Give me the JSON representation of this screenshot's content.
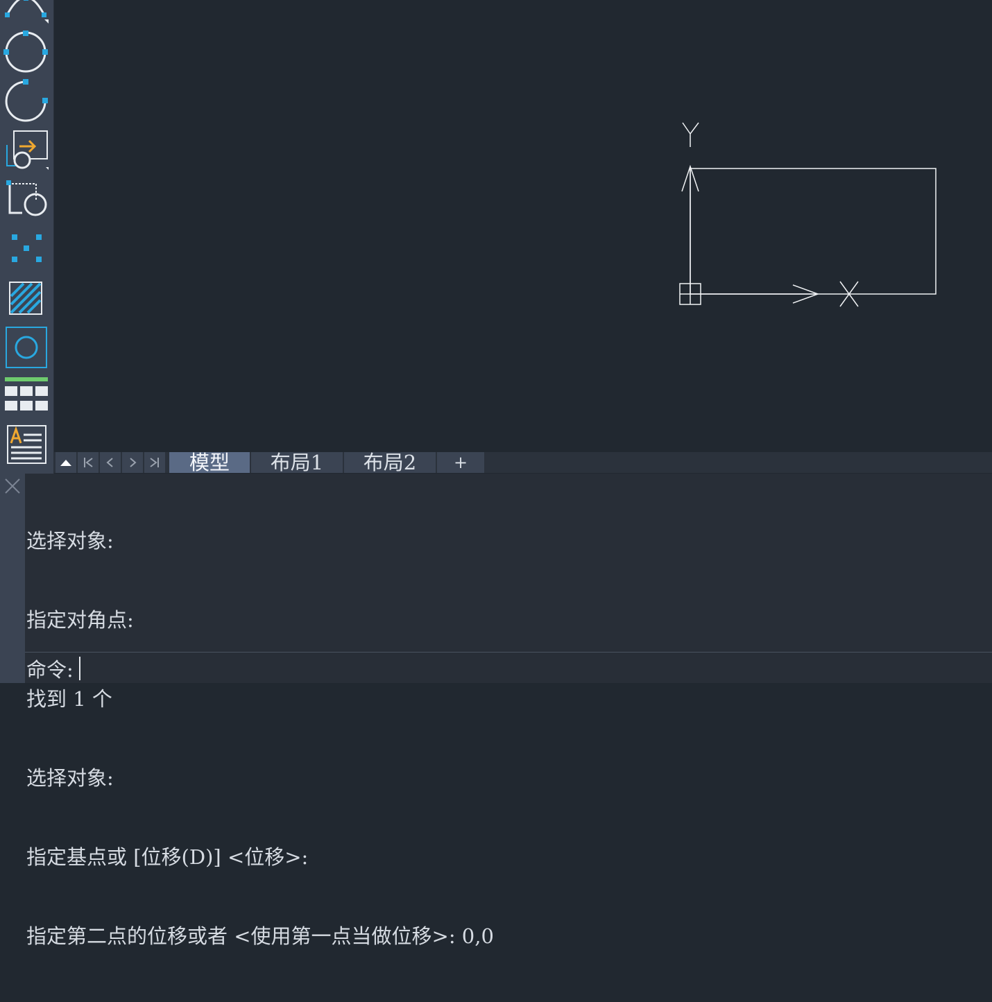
{
  "toolbar": {
    "tools": [
      {
        "name": "arc-icon"
      },
      {
        "name": "circle-icon"
      },
      {
        "name": "revision-cloud-icon"
      },
      {
        "name": "move-icon"
      },
      {
        "name": "block-icon"
      },
      {
        "name": "point-icon"
      },
      {
        "name": "hatch-icon"
      },
      {
        "name": "region-icon"
      },
      {
        "name": "table-icon"
      },
      {
        "name": "mtext-icon"
      }
    ]
  },
  "canvas": {
    "ucs": {
      "y_label": "Y",
      "x_label": "X"
    }
  },
  "tabs": {
    "items": [
      {
        "label": "模型",
        "active": true
      },
      {
        "label": "布局1",
        "active": false
      },
      {
        "label": "布局2",
        "active": false
      }
    ],
    "add_label": "+"
  },
  "command": {
    "history": [
      "选择对象:",
      "指定对角点:",
      "找到 1 个",
      "选择对象:",
      "指定基点或 [位移(D)] <位移>:",
      "指定第二点的位移或者 <使用第一点当做位移>: 0,0"
    ],
    "prompt": "命令:"
  },
  "colors": {
    "canvas_bg": "#212830",
    "panel_bg": "#3b4453",
    "accent_blue": "#29a8e0",
    "active_tab": "#5a6a85"
  }
}
